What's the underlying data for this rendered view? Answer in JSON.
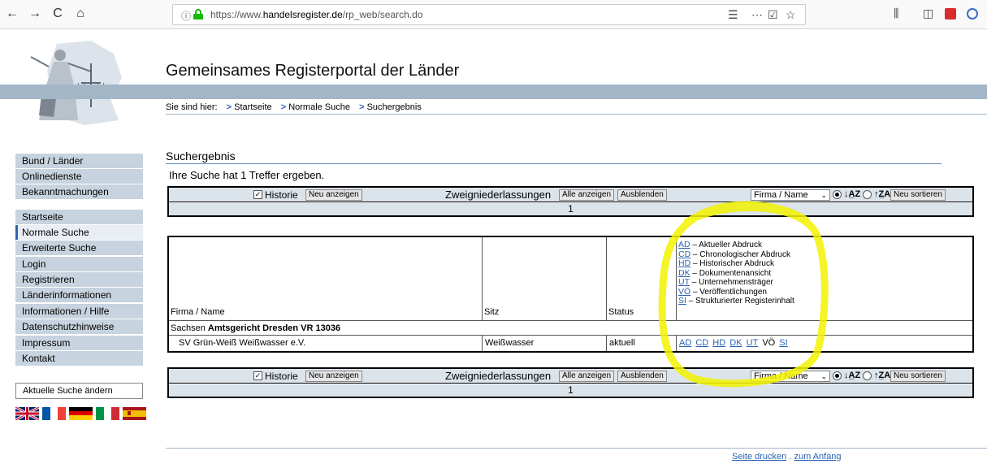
{
  "browser": {
    "url_prefix": "https://www.",
    "url_domain": "handelsregister.de",
    "url_path": "/rp_web/search.do",
    "back": "←",
    "forward": "→",
    "reload": "C",
    "home": "⌂",
    "info": "ⓘ",
    "reader": "☰",
    "more": "⋯",
    "pocket": "☑",
    "star": "☆",
    "library": "⫼",
    "sidebar_btn": "◫"
  },
  "header": {
    "title": "Gemeinsames Registerportal der Länder"
  },
  "breadcrumb": {
    "prefix": "Sie sind hier:",
    "items": [
      "Startseite",
      "Normale Suche",
      "Suchergebnis"
    ],
    "arrow": ">"
  },
  "sidebar": {
    "group1": [
      "Bund / Länder",
      "Onlinedienste",
      "Bekanntmachungen"
    ],
    "group2": [
      "Startseite",
      "Normale Suche",
      "Erweiterte Suche",
      "Login",
      "Registrieren",
      "Länderinformationen",
      "Informationen / Hilfe",
      "Datenschutzhinweise",
      "Impressum",
      "Kontakt"
    ],
    "active": "Normale Suche",
    "change_search": "Aktuelle Suche ändern"
  },
  "results": {
    "heading": "Suchergebnis",
    "count_text": "Ihre Suche hat 1 Treffer ergeben."
  },
  "controls": {
    "historie_label": "Historie",
    "historie_checked": "✓",
    "neu_anzeigen": "Neu anzeigen",
    "zweig_label": "Zweigniederlassungen",
    "alle_anzeigen": "Alle anzeigen",
    "ausblenden": "Ausblenden",
    "sort_select": "Firma / Name",
    "sort_asc": "↓A̲Z",
    "sort_desc": "↑Z̲A",
    "neu_sortieren": "Neu sortieren",
    "page": "1"
  },
  "table": {
    "headers": {
      "firma": "Firma / Name",
      "sitz": "Sitz",
      "status": "Status"
    },
    "legend": [
      {
        "code": "AD",
        "text": "– Aktueller Abdruck"
      },
      {
        "code": "CD",
        "text": "– Chronologischer Abdruck"
      },
      {
        "code": "HD",
        "text": "– Historischer Abdruck"
      },
      {
        "code": "DK",
        "text": "– Dokumentenansicht"
      },
      {
        "code": "UT",
        "text": "– Unternehmensträger"
      },
      {
        "code": "VÖ",
        "text": "– Veröffentlichungen"
      },
      {
        "code": "SI",
        "text": "– Strukturierter Registerinhalt"
      }
    ],
    "court_state": "Sachsen",
    "court_name": "Amtsgericht Dresden VR 13036",
    "row": {
      "name": "SV Grün-Weiß Weißwasser e.V.",
      "sitz": "Weißwasser",
      "status": "aktuell",
      "docs": [
        "AD",
        "CD",
        "HD",
        "DK",
        "UT",
        "VÖ",
        "SI"
      ]
    }
  },
  "footer": {
    "print": "Seite drucken",
    "sep": ".",
    "top": "zum Anfang"
  },
  "colors": {
    "nav_bg": "#c7d3de",
    "band": "#a3b6c8",
    "link": "#2a62b0",
    "highlight": "#f2f200"
  }
}
